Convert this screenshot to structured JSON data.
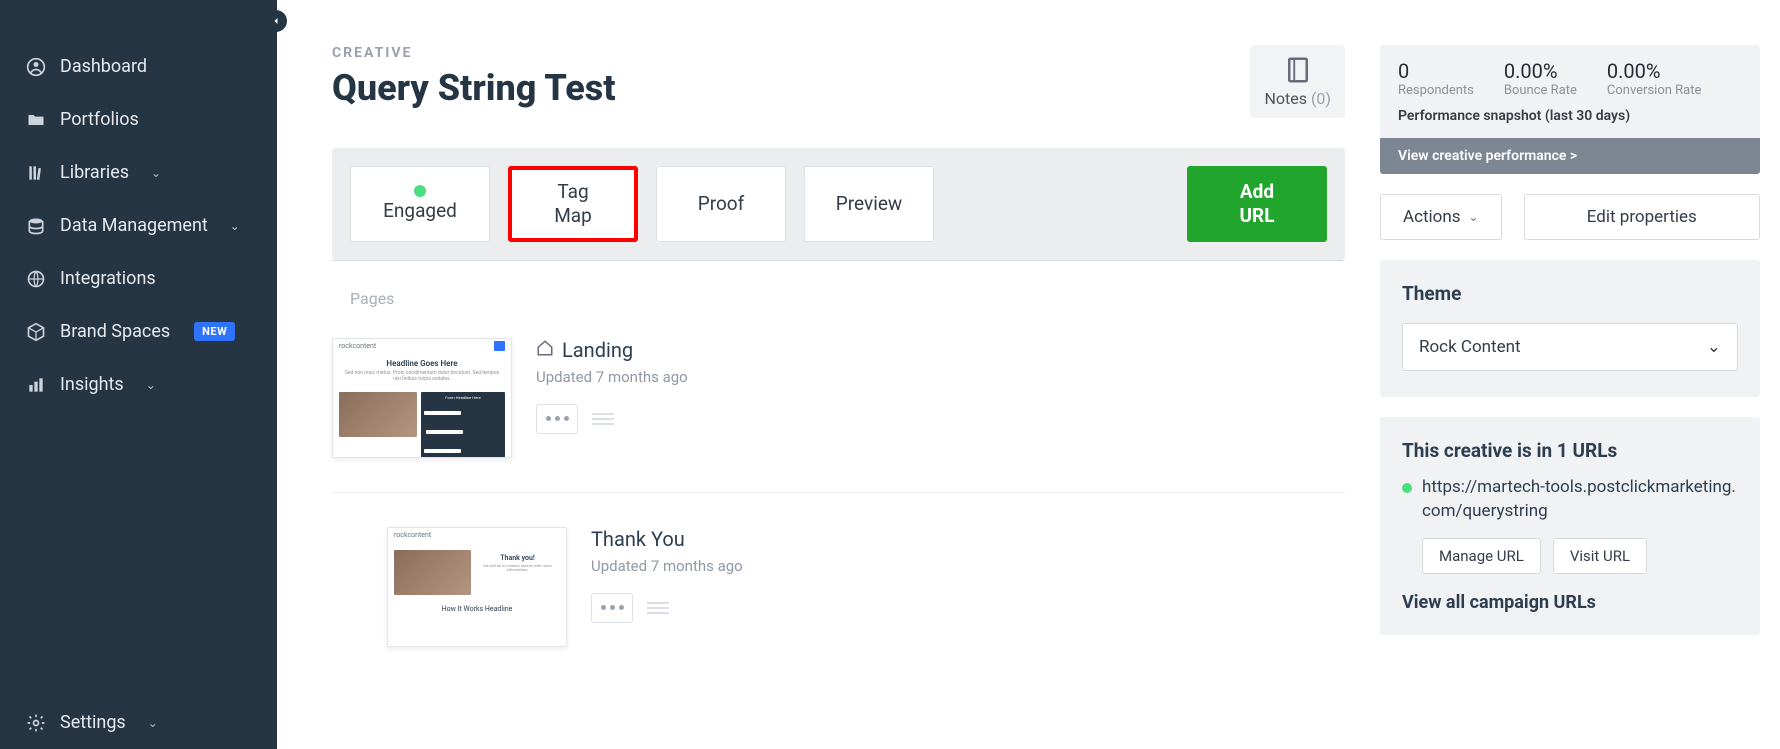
{
  "sidebar": {
    "items": [
      {
        "label": "Dashboard",
        "icon": "user-circle"
      },
      {
        "label": "Portfolios",
        "icon": "folder"
      },
      {
        "label": "Libraries",
        "icon": "library",
        "chevron": true
      },
      {
        "label": "Data Management",
        "icon": "database",
        "chevron": true
      },
      {
        "label": "Integrations",
        "icon": "globe"
      },
      {
        "label": "Brand Spaces",
        "icon": "box",
        "badge": "NEW"
      },
      {
        "label": "Insights",
        "icon": "chart",
        "chevron": true
      }
    ],
    "settings": {
      "label": "Settings",
      "icon": "gear",
      "chevron": true
    }
  },
  "header": {
    "eyebrow": "CREATIVE",
    "title": "Query String Test",
    "notes_label": "Notes",
    "notes_count": "(0)"
  },
  "toolbar": {
    "engaged": "Engaged",
    "tag_map": "Tag Map",
    "proof": "Proof",
    "preview": "Preview",
    "add_url": "Add URL"
  },
  "pages": {
    "section_label": "Pages",
    "items": [
      {
        "name": "Landing",
        "updated": "Updated 7 months ago",
        "thumb_brand": "rockcontent",
        "thumb_headline": "Headline Goes Here",
        "thumb_sub": "Sed non nunc metus. Proin condimentum dolor tincidunt. Sed tempus nisi finibus turpis sodales.",
        "thumb_form_title": "Form Headline Here"
      },
      {
        "name": "Thank You",
        "updated": "Updated 7 months ago",
        "thumb_brand": "rockcontent",
        "thumb_thankyou": "Thank you!",
        "thumb_thankyou_sub": "We will be in contact shortly with more information.",
        "thumb_howit": "How It Works Headline"
      }
    ]
  },
  "performance": {
    "metrics": [
      {
        "val": "0",
        "lbl": "Respondents"
      },
      {
        "val": "0.00%",
        "lbl": "Bounce Rate"
      },
      {
        "val": "0.00%",
        "lbl": "Conversion Rate"
      }
    ],
    "snapshot": "Performance snapshot (last 30 days)",
    "link": "View creative performance >"
  },
  "actions": {
    "actions_label": "Actions",
    "edit_label": "Edit properties"
  },
  "theme": {
    "title": "Theme",
    "selected": "Rock Content"
  },
  "urls": {
    "title": "This creative is in 1 URLs",
    "item": "https://martech-tools.postclickmarketing.com/querystring",
    "manage": "Manage URL",
    "visit": "Visit URL",
    "view_all": "View all campaign URLs"
  }
}
